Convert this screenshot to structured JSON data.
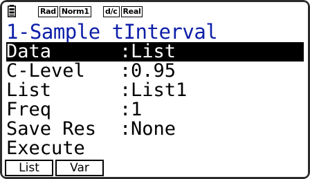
{
  "status_bar": {
    "angle_mode": "Rad",
    "display_mode": "Norm1",
    "fraction_mode": "d/c",
    "complex_mode": "Real",
    "battery_icon": "battery-icon"
  },
  "title": "1-Sample tInterval",
  "rows": [
    {
      "label": "Data",
      "colon": ":",
      "value": "List"
    },
    {
      "label": "C-Level",
      "colon": ":",
      "value": "0.95"
    },
    {
      "label": "List",
      "colon": ":",
      "value": "List1"
    },
    {
      "label": "Freq",
      "colon": ":",
      "value": "1"
    },
    {
      "label": "Save Res",
      "colon": ":",
      "value": "None"
    }
  ],
  "execute_label": "Execute",
  "function_keys": [
    {
      "label": "List"
    },
    {
      "label": "Var"
    }
  ],
  "colors": {
    "title": "#0d1fa8",
    "highlight_bg": "#000000",
    "highlight_fg": "#ffffff"
  }
}
